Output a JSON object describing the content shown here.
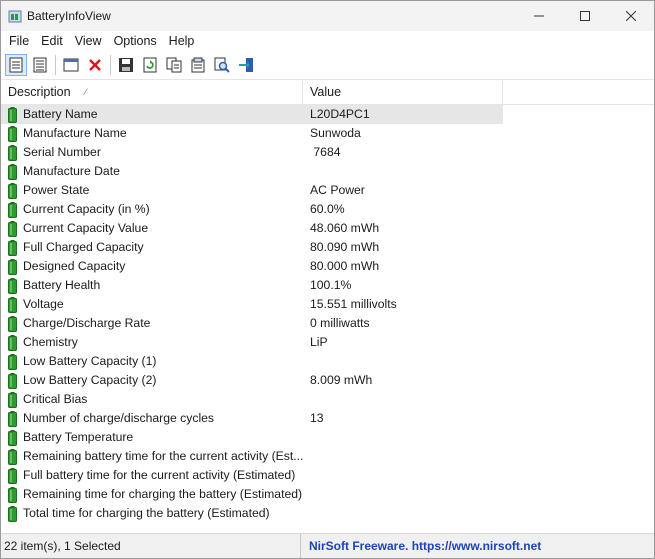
{
  "window": {
    "title": "BatteryInfoView"
  },
  "menu": [
    "File",
    "Edit",
    "View",
    "Options",
    "Help"
  ],
  "columns": {
    "description": "Description",
    "value": "Value"
  },
  "rows": [
    {
      "desc": "Battery Name",
      "value": "L20D4PC1"
    },
    {
      "desc": "Manufacture Name",
      "value": "Sunwoda"
    },
    {
      "desc": "Serial Number",
      "value": " 7684"
    },
    {
      "desc": "Manufacture Date",
      "value": ""
    },
    {
      "desc": "Power State",
      "value": "AC Power"
    },
    {
      "desc": "Current Capacity (in %)",
      "value": "60.0%"
    },
    {
      "desc": "Current Capacity Value",
      "value": "48.060 mWh"
    },
    {
      "desc": "Full Charged Capacity",
      "value": "80.090 mWh"
    },
    {
      "desc": "Designed Capacity",
      "value": "80.000 mWh"
    },
    {
      "desc": "Battery Health",
      "value": "100.1%"
    },
    {
      "desc": "Voltage",
      "value": "15.551 millivolts"
    },
    {
      "desc": "Charge/Discharge Rate",
      "value": "0 milliwatts"
    },
    {
      "desc": "Chemistry",
      "value": "LiP"
    },
    {
      "desc": "Low Battery Capacity (1)",
      "value": ""
    },
    {
      "desc": "Low Battery Capacity (2)",
      "value": "8.009 mWh"
    },
    {
      "desc": "Critical Bias",
      "value": ""
    },
    {
      "desc": "Number of charge/discharge cycles",
      "value": "13"
    },
    {
      "desc": "Battery Temperature",
      "value": ""
    },
    {
      "desc": "Remaining battery time for the current activity (Est...",
      "value": ""
    },
    {
      "desc": "Full battery time for the current activity (Estimated)",
      "value": ""
    },
    {
      "desc": "Remaining time for charging the battery (Estimated)",
      "value": ""
    },
    {
      "desc": "Total  time for charging the battery (Estimated)",
      "value": ""
    }
  ],
  "selected_row": 0,
  "status": {
    "items": "22 item(s), 1 Selected",
    "credit": "NirSoft Freeware. https://www.nirsoft.net"
  },
  "colors": {
    "battery": "#2f9a2f",
    "link": "#1d44b8",
    "selection": "#e6e6e6"
  }
}
